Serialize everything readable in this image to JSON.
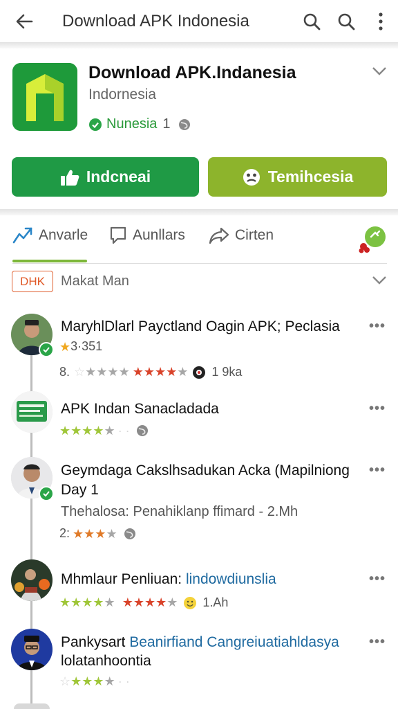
{
  "topbar": {
    "title": "Download APK Indonesia",
    "icons": [
      "back-arrow-icon",
      "search-icon",
      "search-icon",
      "more-vertical-icon"
    ]
  },
  "app": {
    "name": "Download APK.Indanesia",
    "subtitle": "Indornesia",
    "developer": "Nunesia",
    "developer_count": "1"
  },
  "buttons": {
    "primary": "Indcneai",
    "secondary": "Temihcesia"
  },
  "tabs": [
    {
      "label": "Anvarle",
      "icon": "trending-icon",
      "active": true
    },
    {
      "label": "Aunllars",
      "icon": "chat-icon",
      "active": false
    },
    {
      "label": "Cirten",
      "icon": "share-icon",
      "active": false
    }
  ],
  "filter": {
    "tag": "DHK",
    "label": "Makat Man"
  },
  "feed": [
    {
      "title": "MaryhlDlarl Payctland Oagin APK; Peclasia",
      "rating": "3·351",
      "meta_prefix": "8.",
      "meta_count": "1 9ka"
    },
    {
      "title": "APK Indan Sanacladada"
    },
    {
      "title_line1": "Geymdaga Cakslhsadukan Acka (Mapilniong",
      "title_line2": "Day 1",
      "subtitle": "Thehalosa: Penahiklanp ffimard - 2.Mh",
      "meta_prefix": "2:"
    },
    {
      "title_plain": "Mhmlaur Penliuan:",
      "title_highlight": "lindowdiunslia",
      "meta_count": "1.Ah"
    },
    {
      "title_plain": "Pankysart",
      "title_highlight_line1": "Beanirfiand Cangreiuatiahldasya",
      "title_highlight_line2": "lolatanhoontia"
    }
  ],
  "colors": {
    "primary_green": "#1f9a45",
    "secondary_green": "#8db42c",
    "accent_orange": "#e05a28",
    "link_blue": "#1f6aa0"
  }
}
